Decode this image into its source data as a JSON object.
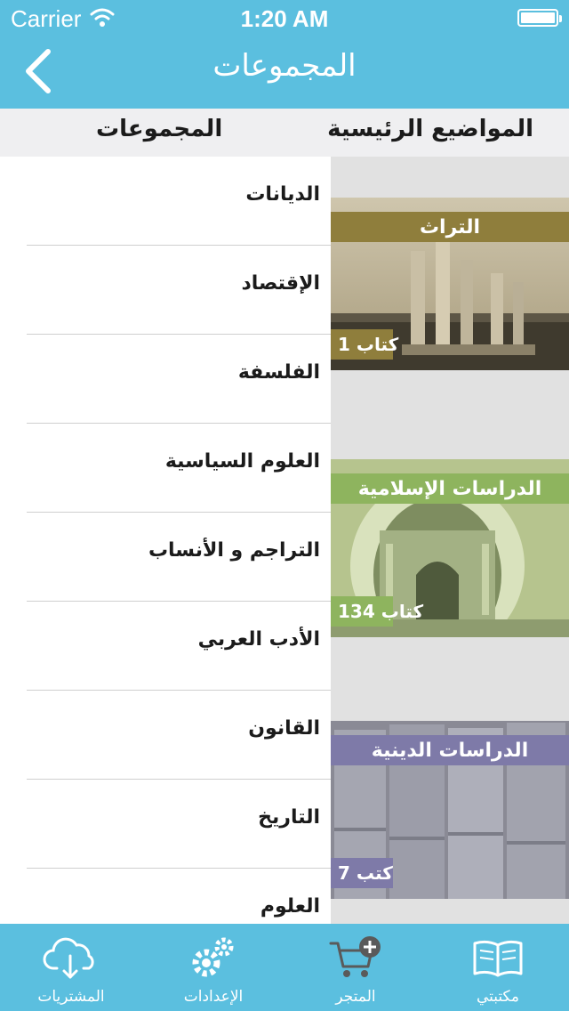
{
  "status_bar": {
    "carrier": "Carrier",
    "time": "1:20 AM"
  },
  "nav": {
    "title": "المجموعات"
  },
  "segments": {
    "main_topics": "المواضيع الرئيسية",
    "groups": "المجموعات"
  },
  "shelf": [
    {
      "title": "التراث",
      "count": "1 كتاب",
      "banner_color": "#8f7e3c"
    },
    {
      "title": "الدراسات الإسلامية",
      "count": "134 كتاب",
      "banner_color": "#8eb45e"
    },
    {
      "title": "الدراسات الدينية",
      "count": "7 كتب",
      "banner_color": "#7e7aa8"
    }
  ],
  "list": [
    "الديانات",
    "الإقتصاد",
    "الفلسفة",
    "العلوم السياسية",
    "التراجم و الأنساب",
    "الأدب العربي",
    "القانون",
    "التاريخ",
    "العلوم"
  ],
  "tabs": {
    "library": "مكتبتي",
    "store": "المتجر",
    "settings": "الإعدادات",
    "purchases": "المشتريات"
  },
  "colors": {
    "primary": "#5bbfdf",
    "segment_bg": "#efeff1",
    "separator": "#cfcfcf"
  }
}
